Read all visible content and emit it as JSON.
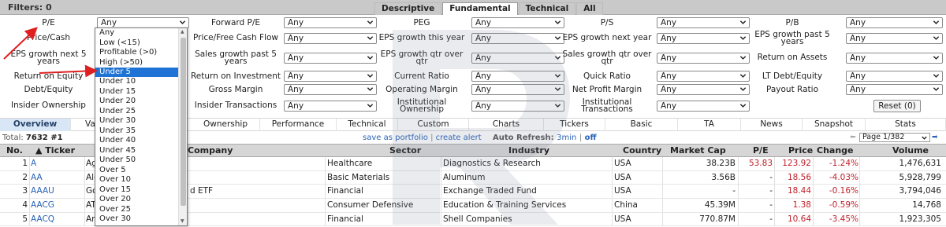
{
  "filters": {
    "label": "Filters: 0"
  },
  "tabs": [
    "Descriptive",
    "Fundamental",
    "Technical",
    "All"
  ],
  "filter_rows": [
    {
      "cells": [
        {
          "label": "P/E",
          "value": "Any"
        },
        {
          "label": "Forward P/E",
          "value": "Any"
        },
        {
          "label": "PEG",
          "value": "Any"
        },
        {
          "label": "P/S",
          "value": "Any"
        },
        {
          "label": "P/B",
          "value": "Any"
        }
      ]
    },
    {
      "cells": [
        {
          "label": "Price/Cash",
          "value": ""
        },
        {
          "label": "Price/Free Cash Flow",
          "value": "Any"
        },
        {
          "label": "EPS growth this year",
          "value": "Any"
        },
        {
          "label": "EPS growth next year",
          "value": "Any"
        },
        {
          "label": "EPS growth past 5 years",
          "value": "Any"
        }
      ]
    },
    {
      "cells": [
        {
          "label": "EPS growth next 5 years",
          "value": ""
        },
        {
          "label": "Sales growth past 5 years",
          "value": "Any"
        },
        {
          "label": "EPS growth qtr over qtr",
          "value": "Any"
        },
        {
          "label": "Sales growth qtr over qtr",
          "value": "Any"
        },
        {
          "label": "Return on Assets",
          "value": "Any"
        }
      ]
    },
    {
      "cells": [
        {
          "label": "Return on Equity",
          "value": ""
        },
        {
          "label": "Return on Investment",
          "value": "Any"
        },
        {
          "label": "Current Ratio",
          "value": "Any"
        },
        {
          "label": "Quick Ratio",
          "value": "Any"
        },
        {
          "label": "LT Debt/Equity",
          "value": "Any"
        }
      ]
    },
    {
      "cells": [
        {
          "label": "Debt/Equity",
          "value": ""
        },
        {
          "label": "Gross Margin",
          "value": "Any"
        },
        {
          "label": "Operating Margin",
          "value": "Any"
        },
        {
          "label": "Net Profit Margin",
          "value": "Any"
        },
        {
          "label": "Payout Ratio",
          "value": "Any"
        }
      ]
    },
    {
      "cells": [
        {
          "label": "Insider Ownership",
          "value": ""
        },
        {
          "label": "Insider Transactions",
          "value": "Any"
        },
        {
          "label": "Institutional Ownership",
          "value": "Any"
        },
        {
          "label": "Institutional Transactions",
          "value": "Any"
        },
        {
          "label": "",
          "value": ""
        }
      ]
    }
  ],
  "reset_label": "Reset (0)",
  "dropdown_options": [
    "Any",
    "Low (<15)",
    "Profitable (>0)",
    "High (>50)",
    "Under 5",
    "Under 10",
    "Under 15",
    "Under 20",
    "Under 25",
    "Under 30",
    "Under 35",
    "Under 40",
    "Under 45",
    "Under 50",
    "Over 5",
    "Over 10",
    "Over 15",
    "Over 20",
    "Over 25",
    "Over 30"
  ],
  "dropdown_highlight": "Under 5",
  "nav": [
    "Overview",
    "Val",
    "Ownership",
    "Performance",
    "Technical",
    "Custom",
    "Charts",
    "Tickers",
    "Basic",
    "TA",
    "News",
    "Snapshot",
    "Stats"
  ],
  "status": {
    "total_label": "Total:",
    "total_value": "7632 #1",
    "save": "save as portfolio",
    "sep": "|",
    "alert": "create alert",
    "auto_label": "Auto Refresh:",
    "auto_value": "3min",
    "auto_sep": "|",
    "off": "off",
    "page": "Page 1/382"
  },
  "columns": [
    "No.",
    "▲ Ticker",
    "Company",
    "Sector",
    "Industry",
    "Country",
    "Market Cap",
    "P/E",
    "Price",
    "Change",
    "Volume"
  ],
  "rows": [
    {
      "no": "1",
      "ticker": "A",
      "company": "Ag",
      "sector": "Healthcare",
      "industry": "Diagnostics & Research",
      "country": "USA",
      "mcap": "38.23B",
      "pe": "53.83",
      "price": "123.92",
      "change": "-1.24%",
      "volume": "1,476,631"
    },
    {
      "no": "2",
      "ticker": "AA",
      "company": "Alc",
      "sector": "Basic Materials",
      "industry": "Aluminum",
      "country": "USA",
      "mcap": "3.56B",
      "pe": "-",
      "price": "18.56",
      "change": "-4.03%",
      "volume": "5,928,799"
    },
    {
      "no": "3",
      "ticker": "AAAU",
      "company": "Go",
      "sector": "Financial",
      "industry": "Exchange Traded Fund",
      "country": "USA",
      "mcap": "-",
      "pe": "-",
      "price": "18.44",
      "change": "-0.16%",
      "volume": "3,794,046"
    },
    {
      "no": "4",
      "ticker": "AACG",
      "company": "ATA",
      "sector": "Consumer Defensive",
      "industry": "Education & Training Services",
      "country": "China",
      "mcap": "45.39M",
      "pe": "-",
      "price": "1.38",
      "change": "-0.59%",
      "volume": "14,768"
    },
    {
      "no": "5",
      "ticker": "AACQ",
      "company": "Artius Acquisition Inc.",
      "sector": "Financial",
      "industry": "Shell Companies",
      "country": "USA",
      "mcap": "770.87M",
      "pe": "-",
      "price": "10.64",
      "change": "-3.45%",
      "volume": "1,923,305"
    }
  ],
  "company_tail": "d ETF",
  "colors": {
    "accent": "#2861b5",
    "negative": "#c0202a",
    "highlight": "#1e73d4",
    "arrow": "#e02020"
  }
}
